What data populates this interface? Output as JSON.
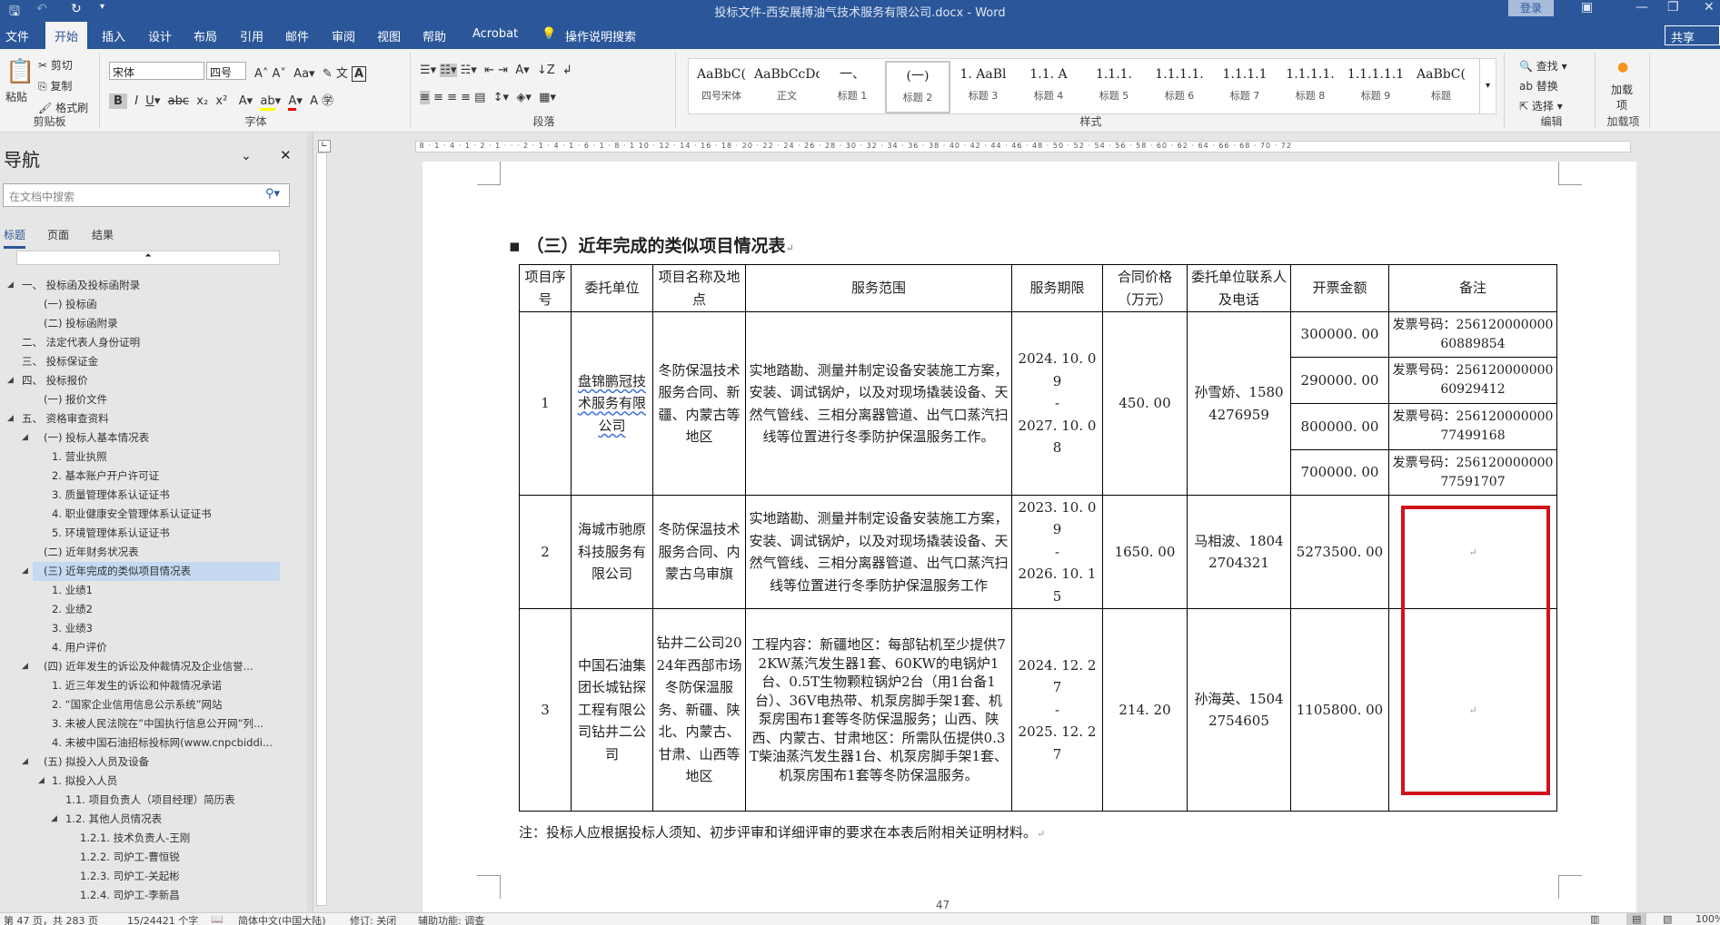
{
  "titlebar": {
    "title": "投标文件-西安展搏油气技术服务有限公司.docx  -  Word",
    "login": "登录",
    "save_icon": "save-icon",
    "undo_icon": "undo-icon",
    "redo_icon": "redo-icon"
  },
  "tabs": [
    "文件",
    "开始",
    "插入",
    "设计",
    "布局",
    "引用",
    "邮件",
    "审阅",
    "视图",
    "帮助",
    "Acrobat",
    "操作说明搜索"
  ],
  "share": "共享",
  "ribbon": {
    "clipboard": {
      "paste": "粘贴",
      "cut": "剪切",
      "copy": "复制",
      "format_painter": "格式刷",
      "label": "剪贴板"
    },
    "font": {
      "name": "宋体",
      "size": "四号",
      "label": "字体"
    },
    "paragraph": {
      "label": "段落"
    },
    "styles": {
      "label": "样式",
      "items": [
        {
          "preview": "AaBbC(",
          "name": "四号宋体"
        },
        {
          "preview": "AaBbCcDdI",
          "name": "正文"
        },
        {
          "preview": "一、",
          "name": "标题 1"
        },
        {
          "preview": "(一)",
          "name": "标题 2"
        },
        {
          "preview": "1.  AaBl",
          "name": "标题 3"
        },
        {
          "preview": "1.1.  A",
          "name": "标题 4"
        },
        {
          "preview": "1.1.1.",
          "name": "标题 5"
        },
        {
          "preview": "1.1.1.1.",
          "name": "标题 6"
        },
        {
          "preview": "1.1.1.1",
          "name": "标题 7"
        },
        {
          "preview": "1.1.1.1.",
          "name": "标题 8"
        },
        {
          "preview": "1.1.1.1.1",
          "name": "标题 9"
        },
        {
          "preview": "AaBbC(",
          "name": "标题"
        }
      ]
    },
    "editing": {
      "find": "查找",
      "replace": "替换",
      "select": "选择",
      "label": "编辑"
    },
    "addins": {
      "button": "加载项",
      "label": "加载项"
    }
  },
  "nav": {
    "title": "导航",
    "search_placeholder": "在文档中搜索",
    "tabs": [
      "标题",
      "页面",
      "结果"
    ],
    "items": [
      {
        "text": "一、  投标函及投标函附录",
        "level": 1,
        "exp": true
      },
      {
        "text": "(一)  投标函",
        "level": 2
      },
      {
        "text": "(二)  投标函附录",
        "level": 2
      },
      {
        "text": "二、  法定代表人身份证明",
        "level": 1
      },
      {
        "text": "三、  投标保证金",
        "level": 1
      },
      {
        "text": "四、  投标报价",
        "level": 1,
        "exp": true
      },
      {
        "text": "(一)  报价文件",
        "level": 2
      },
      {
        "text": "五、  资格审查资料",
        "level": 1,
        "exp": true
      },
      {
        "text": "(一)  投标人基本情况表",
        "level": 2,
        "exp": true
      },
      {
        "text": "1. 营业执照",
        "level": 3
      },
      {
        "text": "2. 基本账户开户许可证",
        "level": 3
      },
      {
        "text": "3. 质量管理体系认证证书",
        "level": 3
      },
      {
        "text": "4. 职业健康安全管理体系认证证书",
        "level": 3
      },
      {
        "text": "5. 环境管理体系认证证书",
        "level": 3
      },
      {
        "text": "(二)  近年财务状况表",
        "level": 2
      },
      {
        "text": "(三)  近年完成的类似项目情况表",
        "level": 2,
        "exp": true,
        "selected": true
      },
      {
        "text": "1. 业绩1",
        "level": 3
      },
      {
        "text": "2. 业绩2",
        "level": 3
      },
      {
        "text": "3. 业绩3",
        "level": 3
      },
      {
        "text": "4. 用户评价",
        "level": 3
      },
      {
        "text": "(四)  近年发生的诉讼及仲裁情况及企业信誉...",
        "level": 2,
        "exp": true
      },
      {
        "text": "1. 近三年发生的诉讼和仲裁情况承诺",
        "level": 3
      },
      {
        "text": "2. “国家企业信用信息公示系统”网站",
        "level": 3
      },
      {
        "text": "3. 未被人民法院在”中国执行信息公开网”列...",
        "level": 3
      },
      {
        "text": "4. 未被中国石油招标投标网(www.cnpcbiddi...",
        "level": 3
      },
      {
        "text": "(五)  拟投入人员及设备",
        "level": 2,
        "exp": true
      },
      {
        "text": "1. 拟投入人员",
        "level": 3,
        "exp": true
      },
      {
        "text": "1.1. 项目负责人（项目经理）简历表",
        "level": 4
      },
      {
        "text": "1.2. 其他人员情况表",
        "level": 4,
        "exp": true
      },
      {
        "text": "1.2.1. 技术负责人-王刚",
        "level": 5
      },
      {
        "text": "1.2.2. 司炉工-曹恒锐",
        "level": 5
      },
      {
        "text": "1.2.3. 司炉工-关起彬",
        "level": 5
      },
      {
        "text": "1.2.4. 司炉工-李新昌",
        "level": 5
      }
    ]
  },
  "document": {
    "heading": "（三）近年完成的类似项目情况表",
    "headers": [
      "项目序号",
      "委托单位",
      "项目名称及地点",
      "服务范围",
      "服务期限",
      "合同价格（万元）",
      "委托单位联系人及电话",
      "开票金额",
      "备注"
    ],
    "rows": [
      {
        "no": "1",
        "client": "盘锦鹏冠技术服务有限公司",
        "project": "冬防保温技术服务合同、新疆、内蒙古等地区",
        "scope": "实地踏勘、测量并制定设备安装施工方案，安装、调试锅炉，以及对现场撬装设备、天然气管线、三相分离器管道、出气口蒸汽扫线等位置进行冬季防护保温服务工作。",
        "period_start": "2024. 10. 09",
        "period_end": "2027. 10. 08",
        "price": "450. 00",
        "contact": "孙雪娇、15804276959",
        "invoices": [
          {
            "amount": "300000. 00",
            "note": "发票号码：25612000000060889854"
          },
          {
            "amount": "290000. 00",
            "note": "发票号码：25612000000060929412"
          },
          {
            "amount": "800000. 00",
            "note": "发票号码：25612000000077499168"
          },
          {
            "amount": "700000. 00",
            "note": "发票号码：25612000000077591707"
          }
        ]
      },
      {
        "no": "2",
        "client": "海城市驰原科技服务有限公司",
        "project": "冬防保温技术服务合同、内蒙古乌审旗",
        "scope": "实地踏勘、测量并制定设备安装施工方案，安装、调试锅炉，以及对现场撬装设备、天然气管线、三相分离器管道、出气口蒸汽扫线等位置进行冬季防护保温服务工作",
        "period_start": "2023. 10. 09",
        "period_end": "2026. 10. 15",
        "price": "1650. 00",
        "contact": "马相波、18042704321",
        "amount": "5273500. 00",
        "note": ""
      },
      {
        "no": "3",
        "client": "中国石油集团长城钻探工程有限公司钻井二公司",
        "project": "钻井二公司2024年西部市场冬防保温服务、新疆、陕北、内蒙古、甘肃、山西等地区",
        "scope": "工程内容：新疆地区：每部钻机至少提供72KW蒸汽发生器1套、60KW的电锅炉1台、0.5T生物颗粒锅炉2台（用1台备1台）、36V电热带、机泵房脚手架1套、机泵房围布1套等冬防保温服务；山西、陕西、内蒙古、甘肃地区：所需队伍提供0.3T柴油蒸汽发生器1台、机泵房脚手架1套、机泵房围布1套等冬防保温服务。",
        "period_start": "2024. 12. 27",
        "period_end": "2025. 12. 27",
        "price": "214. 20",
        "contact": "孙海英、15042754605",
        "amount": "1105800. 00",
        "note": ""
      }
    ],
    "note": "注：投标人应根据投标人须知、初步评审和详细评审的要求在本表后附相关证明材料。",
    "page_number": "47",
    "highlight_color": "#d0121b"
  },
  "status": {
    "page": "第 47 页，共 283 页",
    "words": "15/24421 个字",
    "language": "简体中文(中国大陆)",
    "track": "修订: 关闭",
    "accessibility": "辅助功能: 调查",
    "zoom": "100%"
  }
}
